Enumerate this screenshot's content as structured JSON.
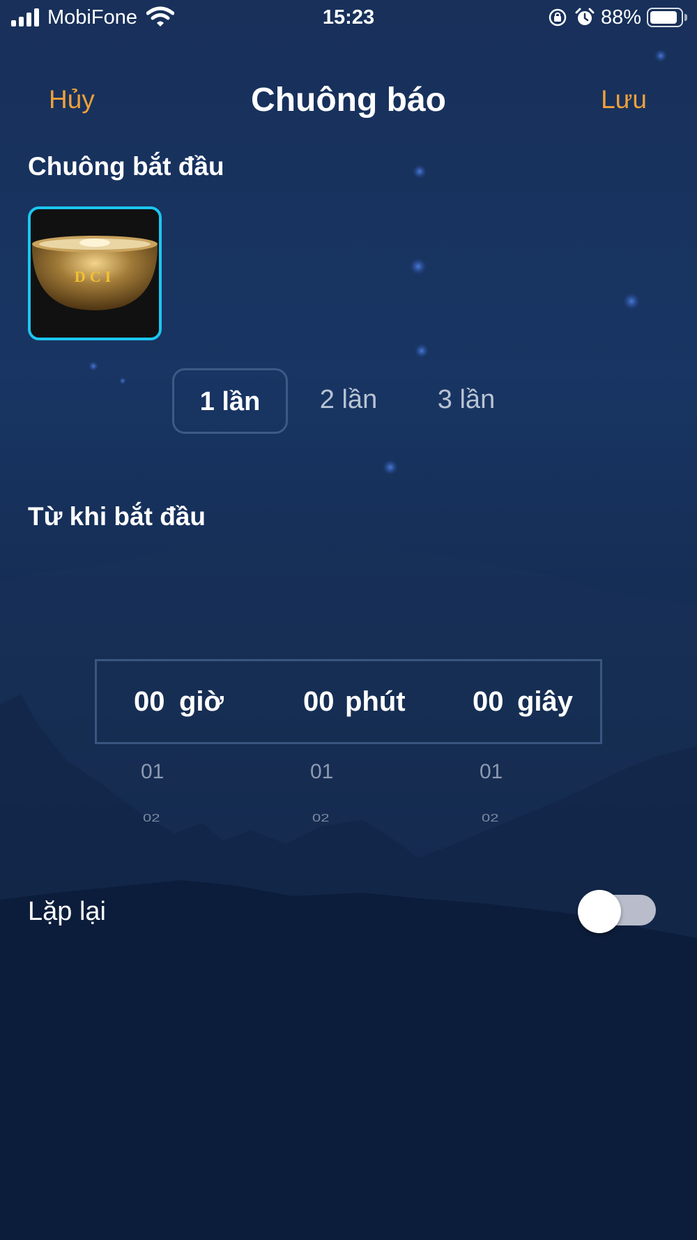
{
  "status_bar": {
    "carrier": "MobiFone",
    "time": "15:23",
    "battery_percent": "88%",
    "battery_level": 0.88,
    "icons": [
      "signal-icon",
      "wifi-icon",
      "orientation-lock-icon",
      "alarm-icon",
      "battery-icon"
    ]
  },
  "nav": {
    "cancel_label": "Hủy",
    "title": "Chuông báo",
    "save_label": "Lưu"
  },
  "start_bell": {
    "section_title": "Chuông bắt đầu",
    "bell_text": "DCI",
    "selected_color": "#1cc6f0"
  },
  "ring_count": {
    "tabs": [
      {
        "label": "1 lần",
        "selected": true
      },
      {
        "label": "2 lần",
        "selected": false
      },
      {
        "label": "3 lần",
        "selected": false
      }
    ]
  },
  "since_start": {
    "section_title": "Từ khi bắt đầu",
    "columns": [
      {
        "value": "00",
        "unit": "giờ",
        "next": "01",
        "next2": "02"
      },
      {
        "value": "00",
        "unit": "phút",
        "next": "01",
        "next2": "02"
      },
      {
        "value": "00",
        "unit": "giây",
        "next": "01",
        "next2": "02"
      }
    ]
  },
  "repeat": {
    "label": "Lặp lại",
    "enabled": false
  },
  "colors": {
    "accent": "#f0a13a",
    "background_top": "#18305a",
    "background_bottom": "#0b1b38"
  }
}
